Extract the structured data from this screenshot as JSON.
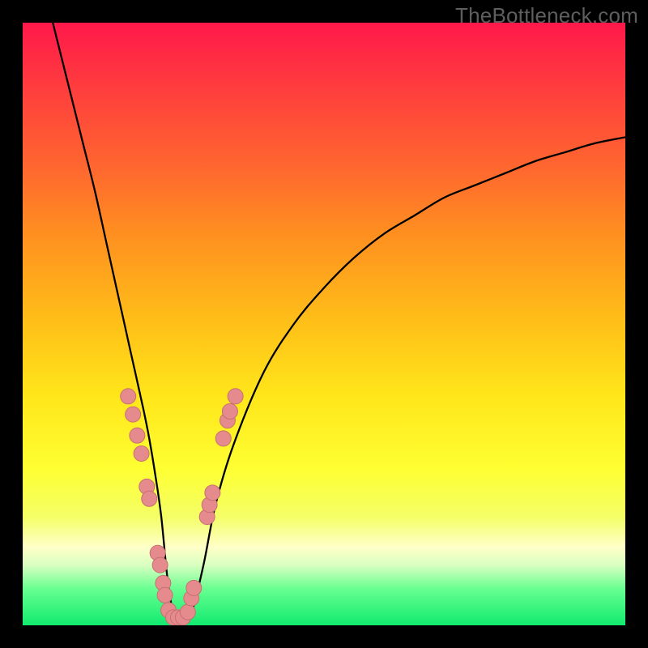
{
  "watermark": "TheBottleneck.com",
  "colors": {
    "frame": "#000000",
    "curve": "#000000",
    "dot_fill": "#e58b8e",
    "dot_stroke": "#c86f72",
    "gradient_top": "#ff184a",
    "gradient_bottom": "#11ea6e"
  },
  "chart_data": {
    "type": "line",
    "title": "",
    "xlabel": "",
    "ylabel": "",
    "xlim": [
      0,
      100
    ],
    "ylim": [
      0,
      100
    ],
    "series": [
      {
        "name": "bottleneck-curve",
        "x": [
          5,
          8,
          10,
          12,
          14,
          16,
          18,
          20,
          21,
          22,
          23,
          24,
          25,
          26,
          27,
          28,
          30,
          32,
          35,
          40,
          45,
          50,
          55,
          60,
          65,
          70,
          75,
          80,
          85,
          90,
          95,
          100
        ],
        "y": [
          100,
          88,
          80,
          72,
          63,
          54,
          45,
          36,
          31,
          25,
          18,
          8,
          2,
          1,
          1,
          2,
          10,
          20,
          30,
          42,
          50,
          56,
          61,
          65,
          68,
          71,
          73,
          75,
          77,
          78.5,
          80,
          81
        ]
      }
    ],
    "annotations": {
      "dots": [
        {
          "x": 17.5,
          "y": 38
        },
        {
          "x": 18.3,
          "y": 35
        },
        {
          "x": 19.0,
          "y": 31.5
        },
        {
          "x": 19.7,
          "y": 28.5
        },
        {
          "x": 20.6,
          "y": 23
        },
        {
          "x": 21.0,
          "y": 21
        },
        {
          "x": 22.4,
          "y": 12
        },
        {
          "x": 22.8,
          "y": 10
        },
        {
          "x": 23.3,
          "y": 7
        },
        {
          "x": 23.6,
          "y": 5
        },
        {
          "x": 24.2,
          "y": 2.5
        },
        {
          "x": 25.0,
          "y": 1.3
        },
        {
          "x": 25.8,
          "y": 1.3
        },
        {
          "x": 26.6,
          "y": 1.3
        },
        {
          "x": 27.4,
          "y": 2.2
        },
        {
          "x": 28.0,
          "y": 4.5
        },
        {
          "x": 28.4,
          "y": 6.2
        },
        {
          "x": 30.6,
          "y": 18
        },
        {
          "x": 31.0,
          "y": 20
        },
        {
          "x": 31.5,
          "y": 22
        },
        {
          "x": 33.3,
          "y": 31
        },
        {
          "x": 34.0,
          "y": 34
        },
        {
          "x": 34.4,
          "y": 35.5
        },
        {
          "x": 35.3,
          "y": 38
        }
      ]
    }
  }
}
